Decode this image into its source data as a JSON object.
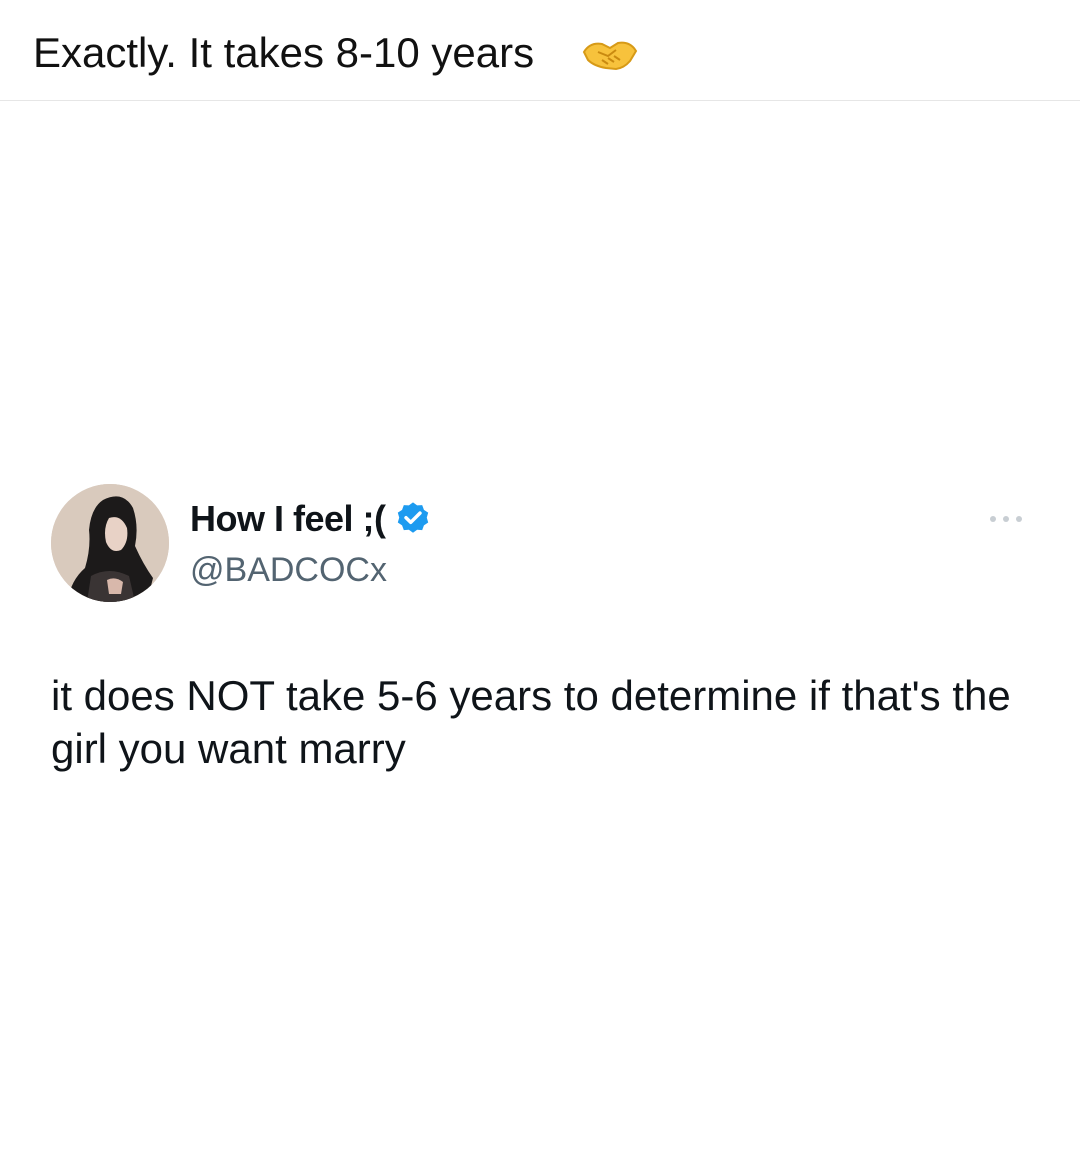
{
  "caption": {
    "text": "Exactly. It takes 8-10 years",
    "emoji_icon": "handshake-icon"
  },
  "tweet": {
    "display_name": "How I feel ;(",
    "verified_icon": "verified-badge-icon",
    "verified_color": "#1d9bf0",
    "handle": "@BADCOCx",
    "more_icon": "more-options-icon",
    "body": "it does NOT take 5-6 years to determine if that's the girl you want marry"
  }
}
